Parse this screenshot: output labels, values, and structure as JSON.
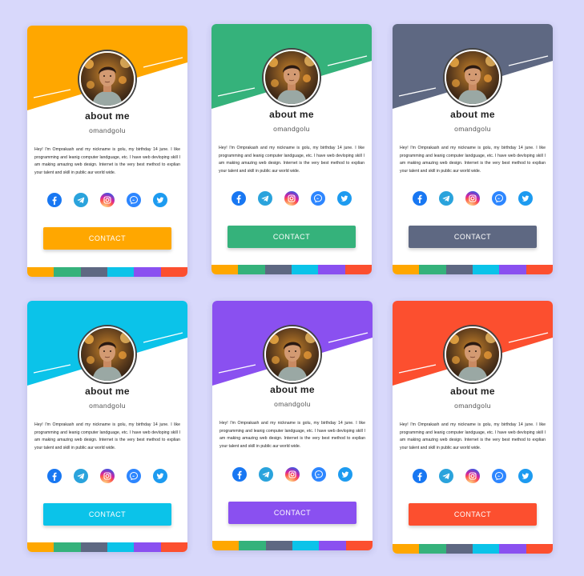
{
  "profile": {
    "title": "about me",
    "handle": "omandgolu",
    "bio": "Hey! I'm Omprakash and my nickname is golu, my birthday 14 june. I like programming and leanig computer landguage, etc. I have web devloping skill I am making amazing web design. Internet is the very best method to explian your talent and skill in public aur world wide.",
    "contact_label": "CONTACT"
  },
  "social_icons": [
    "facebook-icon",
    "telegram-icon",
    "instagram-icon",
    "messenger-icon",
    "twitter-icon"
  ],
  "stripe_colors": [
    "#ffa700",
    "#35b27b",
    "#5e6882",
    "#0bc3e9",
    "#8a50f0",
    "#fc4f2f"
  ],
  "cards": [
    {
      "accent": "#ffa700"
    },
    {
      "accent": "#35b27b"
    },
    {
      "accent": "#5e6882"
    },
    {
      "accent": "#0bc3e9"
    },
    {
      "accent": "#8a50f0"
    },
    {
      "accent": "#fc4f2f"
    }
  ]
}
